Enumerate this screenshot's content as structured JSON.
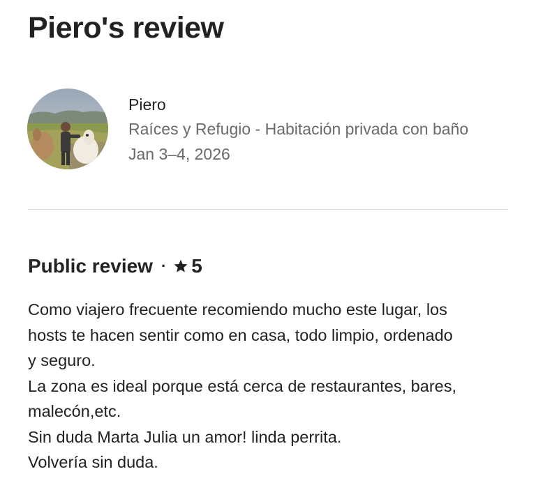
{
  "page": {
    "title": "Piero's review"
  },
  "reviewer": {
    "name": "Piero",
    "listing": "Raíces y Refugio - Habitación privada con baño",
    "dates": "Jan 3–4, 2026",
    "avatar_icon": "profile-photo"
  },
  "public_review": {
    "heading": "Public review",
    "separator": "·",
    "star_icon": "star-icon",
    "rating": "5",
    "text_lines": [
      "Como viajero frecuente recomiendo mucho este lugar, los",
      "hosts te hacen sentir como en casa, todo limpio, ordenado",
      "y seguro.",
      "La zona es ideal porque está cerca de restaurantes, bares,",
      "malecón,etc.",
      "Sin duda  Marta Julia un amor! linda perrita.",
      "Volvería sin duda."
    ]
  },
  "colors": {
    "text_primary": "#222222",
    "text_secondary": "#6a6a6a",
    "divider": "#dddddd"
  }
}
